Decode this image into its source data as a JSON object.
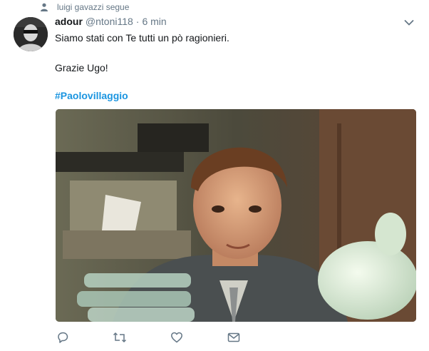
{
  "context": {
    "text": "luigi gavazzi segue",
    "icon": "person-icon"
  },
  "tweet": {
    "display_name": "adour",
    "handle": "@ntoni118",
    "separator": "·",
    "time": "6 min",
    "lines": [
      "Siamo stati con Te tutti un pò ragionieri.",
      "Grazie Ugo!"
    ],
    "hashtag": "#Paolovillaggio"
  },
  "actions": [
    "reply-icon",
    "retweet-icon",
    "like-icon",
    "direct-message-icon"
  ],
  "colors": {
    "link": "#1b95e0",
    "secondary": "#657786",
    "text": "#14171a",
    "icon": "#657786"
  }
}
